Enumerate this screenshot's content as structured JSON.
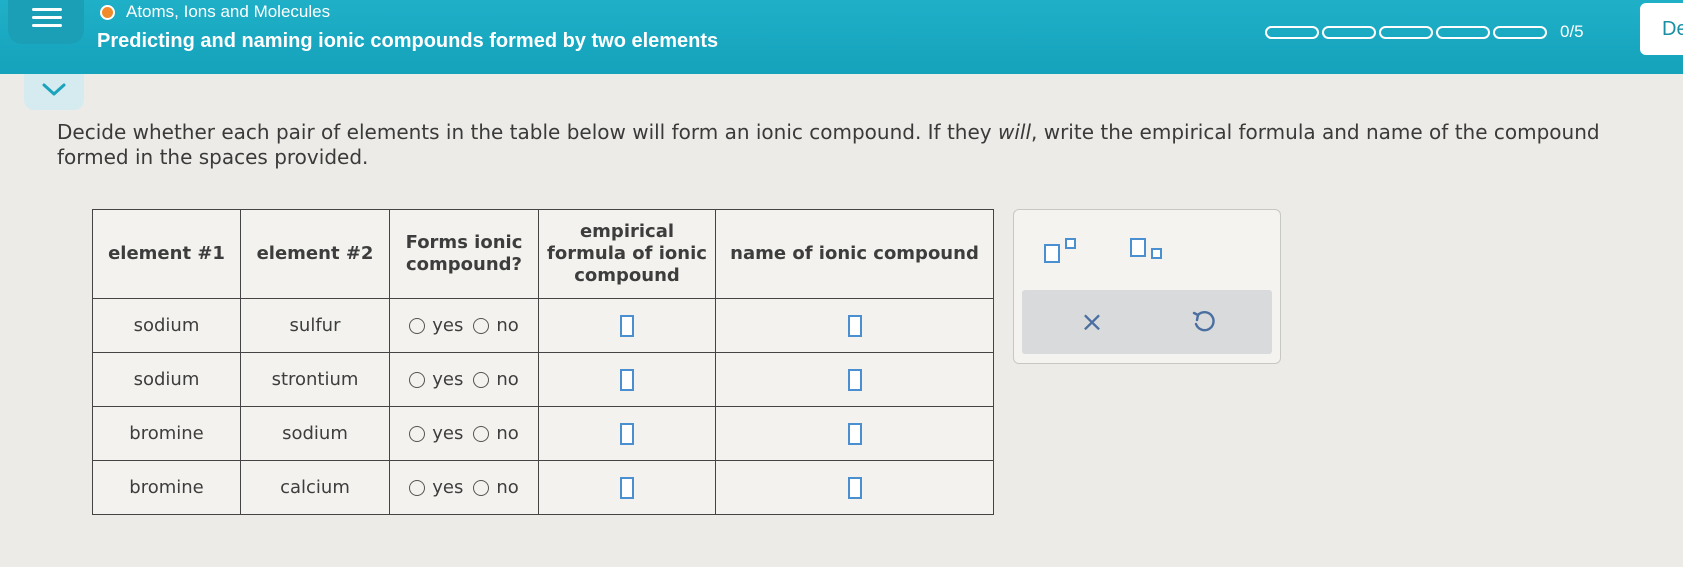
{
  "header": {
    "topic": "Atoms, Ions and Molecules",
    "title": "Predicting and naming ionic compounds formed by two elements",
    "progress_text": "0/5",
    "progress_segments": 5,
    "progress_filled": 0,
    "right_button": "De"
  },
  "instructions": {
    "part1": "Decide whether each pair of elements in the table below will form an ionic compound. If they ",
    "emphasis": "will",
    "part2": ", write the empirical formula and name of the compound formed in the spaces provided."
  },
  "table": {
    "headers": {
      "element1": "element #1",
      "element2": "element #2",
      "forms_line1": "Forms ionic",
      "forms_line2": "compound?",
      "formula_line1": "empirical",
      "formula_line2": "formula of ionic",
      "formula_line3": "compound",
      "name": "name of ionic compound"
    },
    "yes_label": "yes",
    "no_label": "no",
    "rows": [
      {
        "element1": "sodium",
        "element2": "sulfur"
      },
      {
        "element1": "sodium",
        "element2": "strontium"
      },
      {
        "element1": "bromine",
        "element2": "sodium"
      },
      {
        "element1": "bromine",
        "element2": "calcium"
      }
    ]
  },
  "toolbox": {
    "clear_symbol": "×",
    "undo_icon": "undo-icon",
    "superscript_icon": "superscript-icon",
    "subscript_icon": "subscript-icon"
  },
  "colors": {
    "header_bg": "#17a8c0",
    "input_border": "#4a8fd0",
    "topic_dot": "#f08a2b"
  }
}
